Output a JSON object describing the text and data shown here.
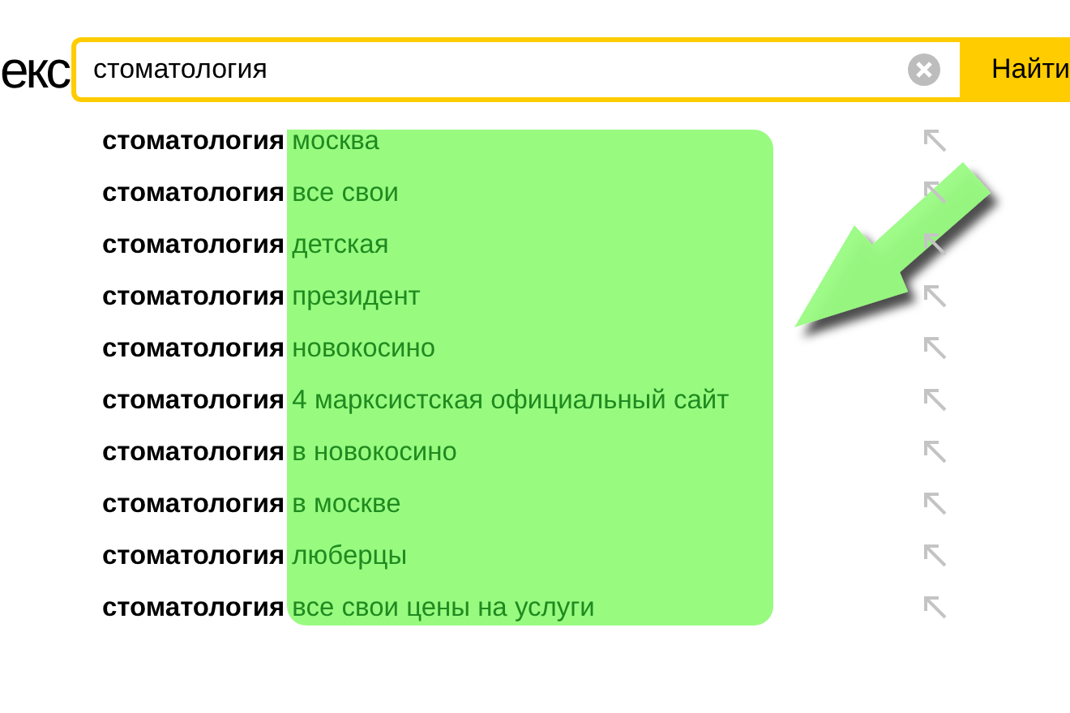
{
  "logo_fragment": "екс",
  "search": {
    "value": "стоматология",
    "button": "Найти"
  },
  "suggestions": [
    {
      "text": "**стоматология** москва"
    },
    {
      "text": "**стоматология** все свои"
    },
    {
      "text": "**стоматология** детская"
    },
    {
      "text": "**стоматология** президент"
    },
    {
      "text": "**стоматология** новокосино"
    },
    {
      "text": "**стоматология** 4 марксистская официальный сайт"
    },
    {
      "text": "**стоматология** в новокосино"
    },
    {
      "text": "**стоматология** в москве"
    },
    {
      "text": "**стоматология** люберцы"
    },
    {
      "text": "**стоматология** все свои цены на услуги"
    }
  ]
}
